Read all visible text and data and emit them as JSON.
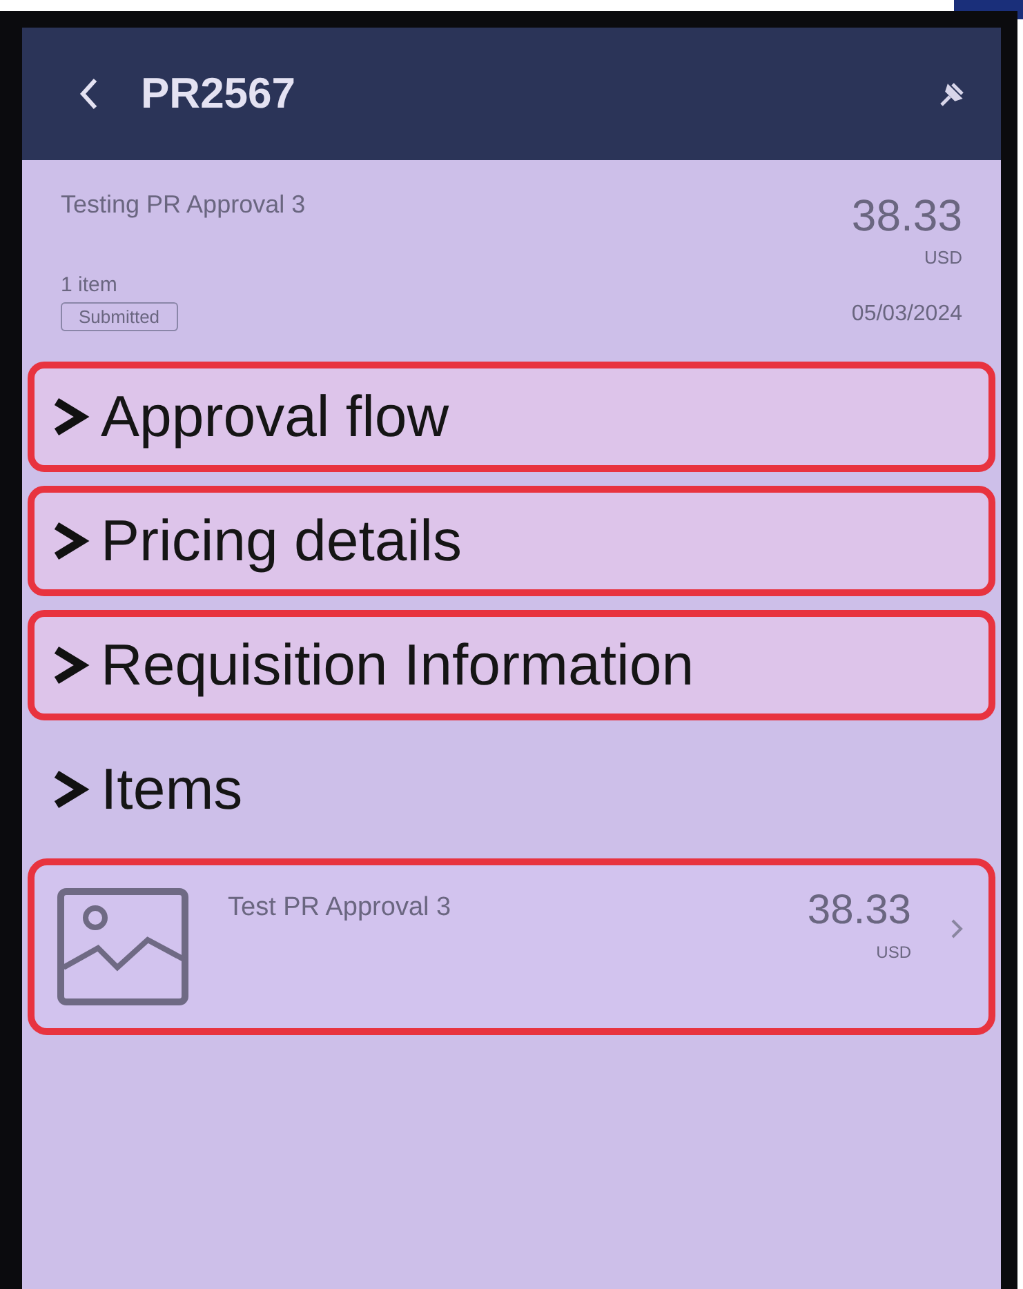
{
  "header": {
    "title": "PR2567"
  },
  "summary": {
    "title": "Testing PR Approval 3",
    "amount": "38.33",
    "currency": "USD",
    "item_count": "1 item",
    "status": "Submitted",
    "date": "05/03/2024"
  },
  "sections": [
    {
      "label": "Approval flow",
      "highlighted": true
    },
    {
      "label": "Pricing details",
      "highlighted": true
    },
    {
      "label": "Requisition Information",
      "highlighted": true
    },
    {
      "label": "Items",
      "highlighted": false
    }
  ],
  "items": [
    {
      "name": "Test PR Approval 3",
      "amount": "38.33",
      "currency": "USD",
      "highlighted": true
    }
  ]
}
